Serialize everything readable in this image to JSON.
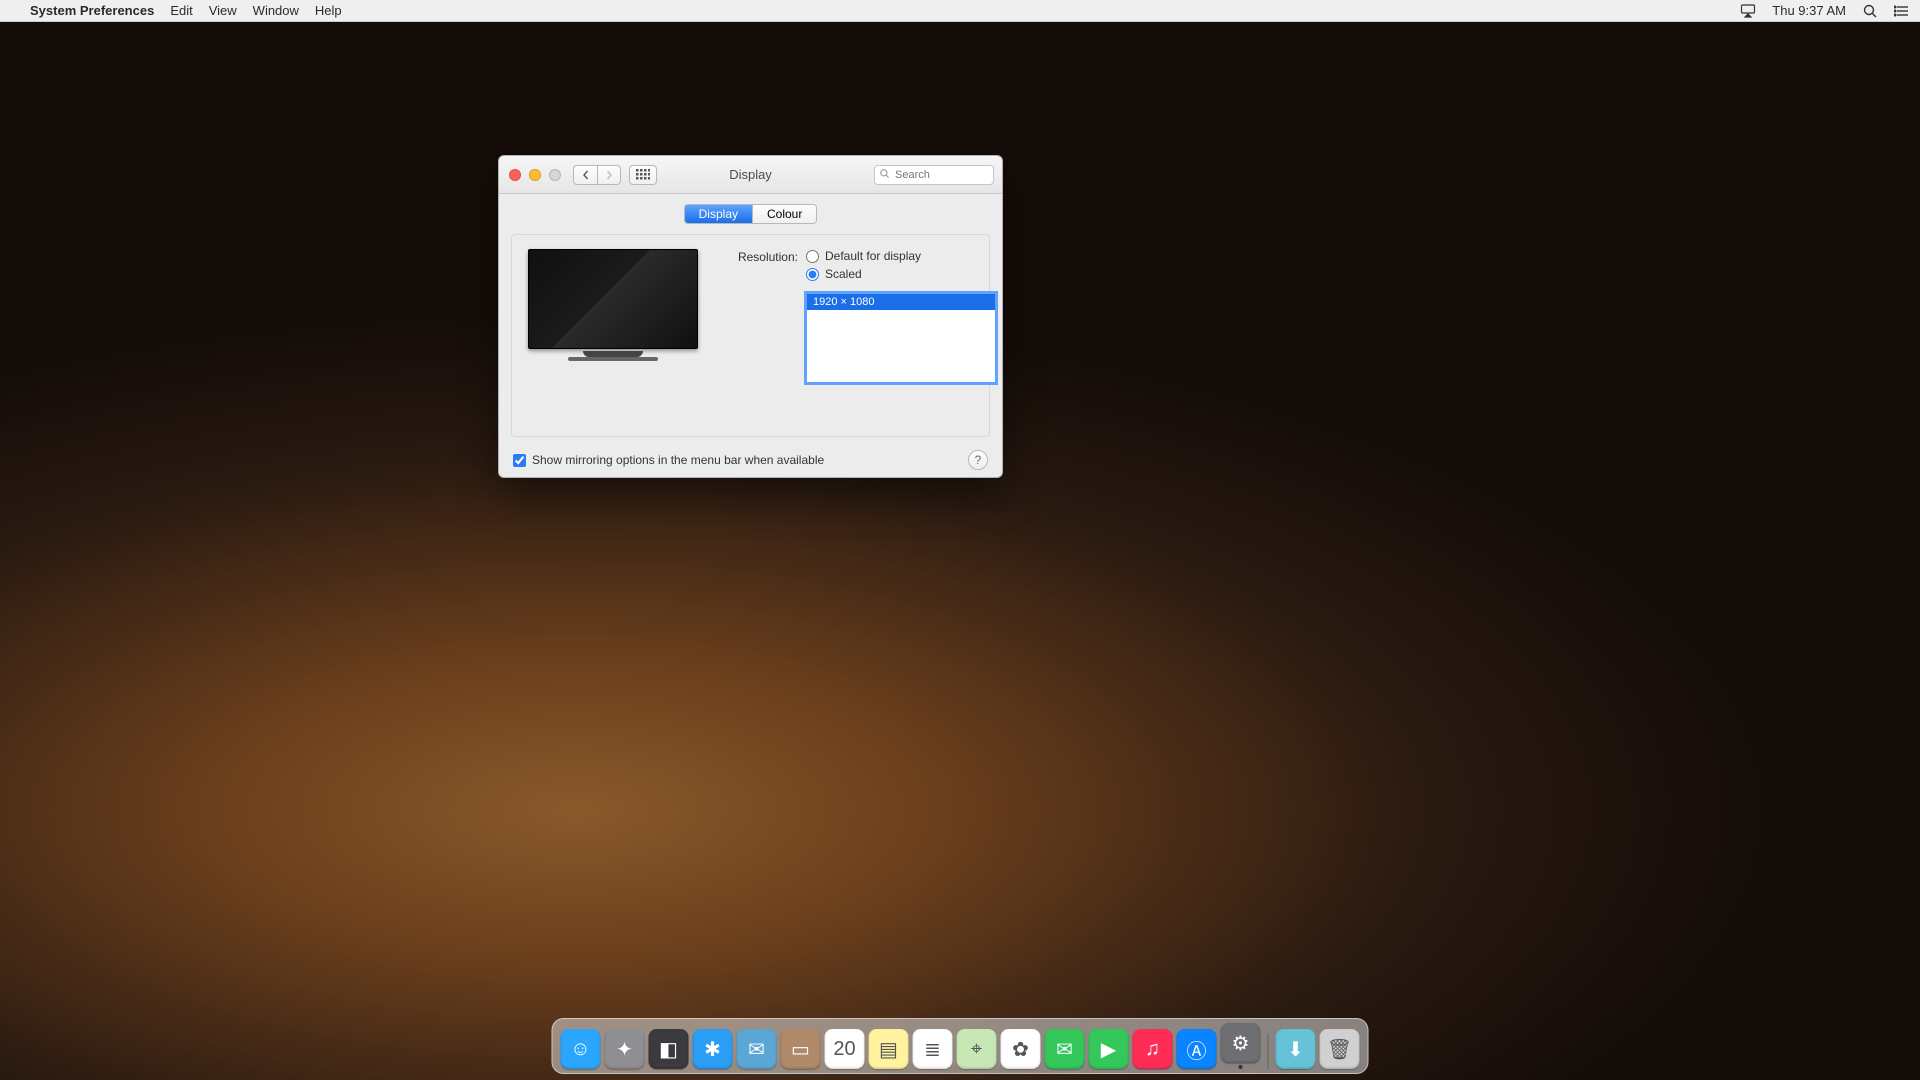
{
  "menubar": {
    "app_name": "System Preferences",
    "items": [
      "Edit",
      "View",
      "Window",
      "Help"
    ],
    "clock": "Thu 9:37 AM"
  },
  "window": {
    "title": "Display",
    "search_placeholder": "Search",
    "tabs": [
      {
        "label": "Display",
        "active": true
      },
      {
        "label": "Colour",
        "active": false
      }
    ],
    "resolution_label": "Resolution:",
    "radio_default": "Default for display",
    "radio_scaled": "Scaled",
    "selected_radio": "scaled",
    "resolutions": [
      {
        "label": "1920 × 1080",
        "selected": true
      }
    ],
    "mirroring_label": "Show mirroring options in the menu bar when available",
    "mirroring_checked": true
  },
  "dock": {
    "apps": [
      {
        "name": "finder",
        "color": "#2aa6ff",
        "glyph": "☺"
      },
      {
        "name": "launchpad",
        "color": "#8e8e93",
        "glyph": "✦"
      },
      {
        "name": "mission-control",
        "color": "#3b3b3f",
        "glyph": "◧"
      },
      {
        "name": "safari",
        "color": "#2a9df4",
        "glyph": "✱"
      },
      {
        "name": "mail",
        "color": "#5aa7d6",
        "glyph": "✉"
      },
      {
        "name": "contacts",
        "color": "#b08968",
        "glyph": "▭"
      },
      {
        "name": "calendar",
        "color": "#ffffff",
        "glyph": "20"
      },
      {
        "name": "notes",
        "color": "#fff3a0",
        "glyph": "▤"
      },
      {
        "name": "reminders",
        "color": "#ffffff",
        "glyph": "≣"
      },
      {
        "name": "maps",
        "color": "#c7e8b4",
        "glyph": "⌖"
      },
      {
        "name": "photos",
        "color": "#ffffff",
        "glyph": "✿"
      },
      {
        "name": "messages",
        "color": "#34c759",
        "glyph": "✉"
      },
      {
        "name": "facetime",
        "color": "#34c759",
        "glyph": "▶"
      },
      {
        "name": "itunes",
        "color": "#ff2d55",
        "glyph": "♫"
      },
      {
        "name": "app-store",
        "color": "#0a84ff",
        "glyph": "Ⓐ"
      },
      {
        "name": "system-preferences",
        "color": "#6e6e73",
        "glyph": "⚙",
        "running": true
      }
    ],
    "right": [
      {
        "name": "downloads",
        "color": "#66c2d6",
        "glyph": "⬇"
      },
      {
        "name": "trash",
        "color": "#d0d0d0",
        "glyph": "🗑"
      }
    ]
  }
}
